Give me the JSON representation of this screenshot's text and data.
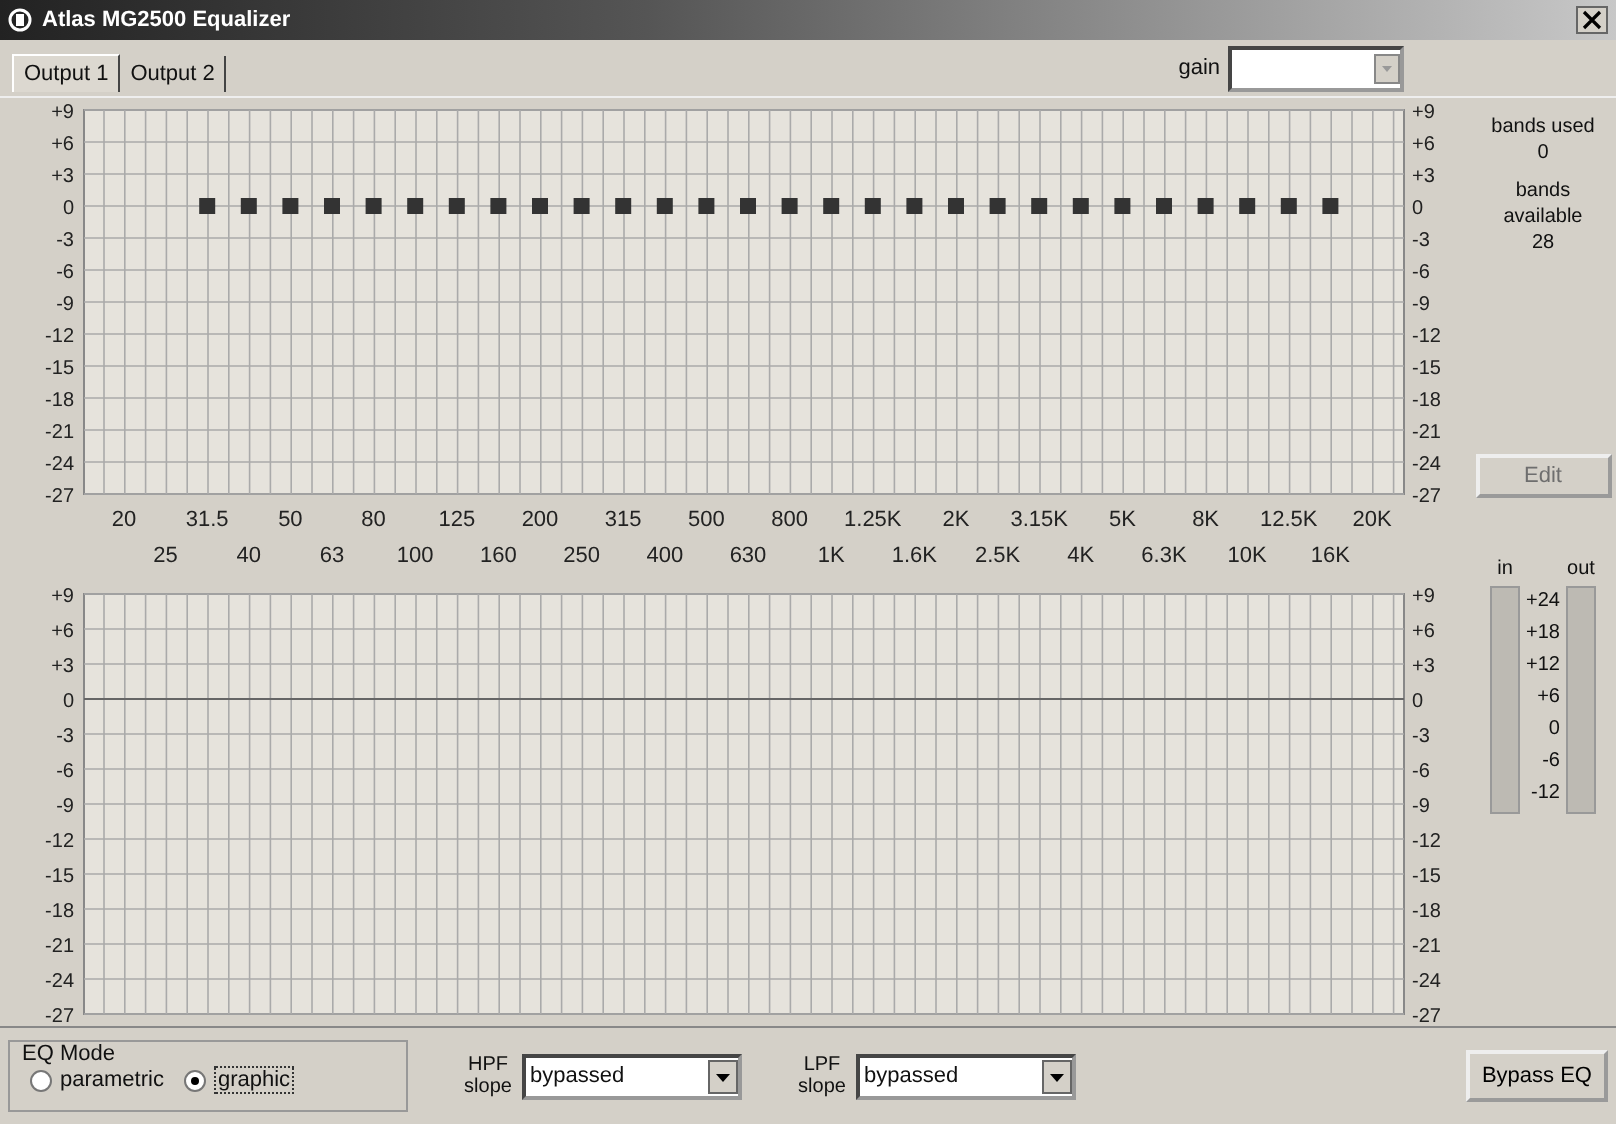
{
  "window": {
    "title": "Atlas MG2500 Equalizer"
  },
  "tabs": [
    {
      "label": "Output 1",
      "selected": true
    },
    {
      "label": "Output 2",
      "selected": false
    }
  ],
  "gain": {
    "label": "gain"
  },
  "eq_graph": {
    "right_axis": [
      "+9",
      "+6",
      "+3",
      "0",
      "-3",
      "-6",
      "-9",
      "-12",
      "-15",
      "-18",
      "-21",
      "-24",
      "-27"
    ],
    "chart_data": {
      "type": "scatter",
      "categories": [
        "20",
        "25",
        "31.5",
        "40",
        "50",
        "63",
        "80",
        "100",
        "125",
        "160",
        "200",
        "250",
        "315",
        "400",
        "500",
        "630",
        "800",
        "1K",
        "1.25K",
        "1.6K",
        "2K",
        "2.5K",
        "3.15K",
        "4K",
        "5K",
        "6.3K",
        "8K",
        "10K",
        "12.5K",
        "16K",
        "20K"
      ],
      "grid": true,
      "series": [
        {
          "color": "#333333",
          "values": [
            null,
            null,
            0,
            0,
            0,
            0,
            0,
            0,
            0,
            0,
            0,
            0,
            0,
            0,
            0,
            0,
            0,
            0,
            0,
            0,
            0,
            0,
            0,
            0,
            0,
            0,
            0,
            0,
            0,
            0,
            null
          ]
        }
      ],
      "ylim": [
        -27,
        9
      ],
      "yticks": [
        {
          "value": 9,
          "label": "+9"
        },
        {
          "value": 6,
          "label": "+6"
        },
        {
          "value": 3,
          "label": "+3"
        },
        0,
        -3,
        -6,
        -9,
        -12,
        -15,
        -18,
        -21,
        -24,
        -27
      ]
    }
  },
  "bands": {
    "used_label": "bands used",
    "used": "0",
    "available_label": "bands available",
    "available": "28"
  },
  "edit_button": {
    "label": "Edit",
    "disabled": true
  },
  "response_graph": {
    "left_axis": [
      "+9",
      "+6",
      "+3",
      "0",
      "-3",
      "-6",
      "-9",
      "-12",
      "-15",
      "-18",
      "-21",
      "-24",
      "-27"
    ],
    "right_axis": [
      "+9",
      "+6",
      "+3",
      "0",
      "-3",
      "-6",
      "-9",
      "-12",
      "-15",
      "-18",
      "-21",
      "-24",
      "-27"
    ]
  },
  "meters": {
    "scale": [
      "+24",
      "+18",
      "+12",
      "+6",
      "0",
      "-6",
      "-12"
    ],
    "channels": [
      {
        "label": "in",
        "level": 0
      },
      {
        "label": "out",
        "level": 0
      }
    ]
  },
  "eq_mode": {
    "title": "EQ Mode",
    "options": [
      {
        "label": "parametric",
        "selected": false
      },
      {
        "label": "graphic",
        "selected": true
      }
    ]
  },
  "filters": [
    {
      "label": "HPF slope",
      "value": "bypassed"
    },
    {
      "label": "LPF slope",
      "value": "bypassed"
    }
  ],
  "bypass_button": {
    "label": "Bypass EQ"
  }
}
